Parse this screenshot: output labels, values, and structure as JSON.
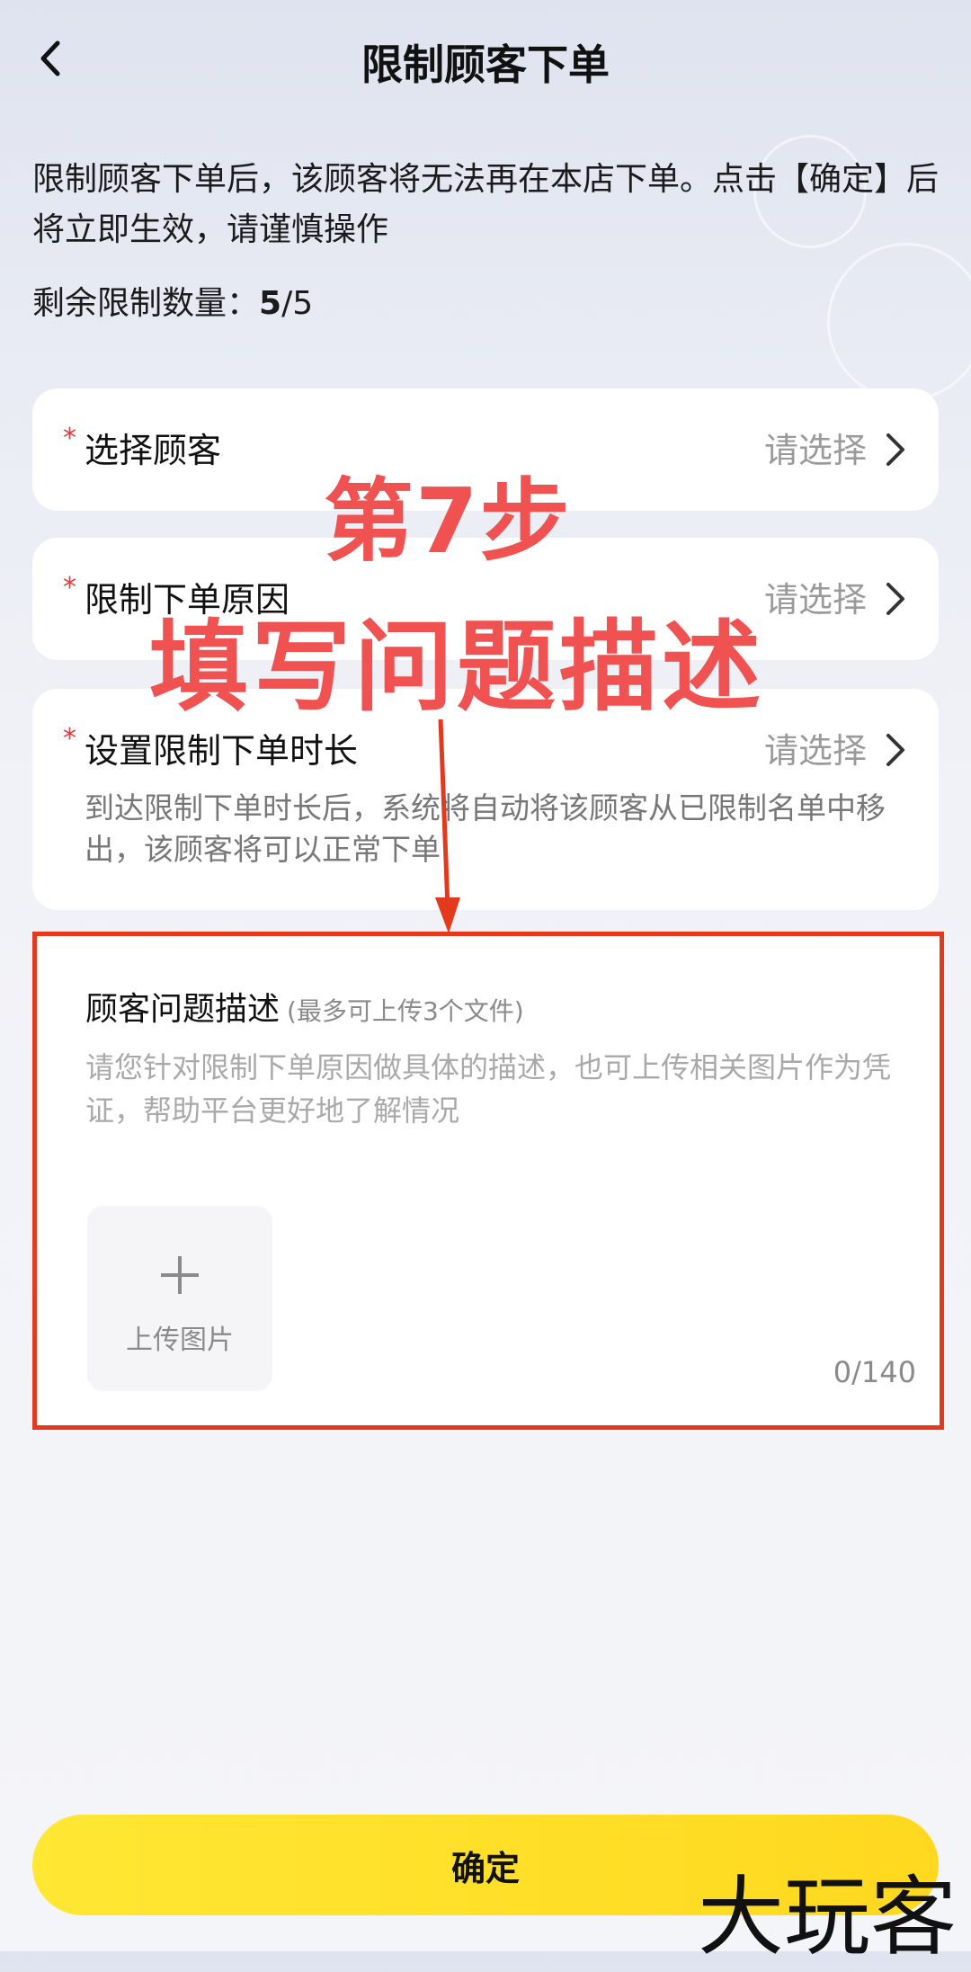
{
  "header": {
    "title": "限制顾客下单"
  },
  "notice": {
    "text": "限制顾客下单后，该顾客将无法再在本店下单。点击【确定】后将立即生效，请谨慎操作"
  },
  "remaining": {
    "label": "剩余限制数量：",
    "used": "5",
    "slash_total": "/5"
  },
  "fields": [
    {
      "required": "*",
      "label": "选择顾客",
      "value": "请选择"
    },
    {
      "required": "*",
      "label": "限制下单原因",
      "value": "请选择"
    },
    {
      "required": "*",
      "label": "设置限制下单时长",
      "value": "请选择",
      "hint": "到达限制下单时长后，系统将自动将该顾客从已限制名单中移出，该顾客将可以正常下单"
    }
  ],
  "description": {
    "title": "顾客问题描述",
    "subtitle": "(最多可上传3个文件)",
    "placeholder": "请您针对限制下单原因做具体的描述，也可上传相关图片作为凭证，帮助平台更好地了解情况",
    "upload_label": "上传图片",
    "counter": "0/140"
  },
  "overlay": {
    "step": "第7步",
    "instruction": "填写问题描述"
  },
  "confirm_label": "确定",
  "watermark": "大玩客",
  "colors": {
    "accent_yellow": "#ffe733",
    "required_red": "#e53935",
    "annotation_red": "#f05252",
    "highlight_border": "#e5391e"
  },
  "icons": {
    "back": "chevron-left-icon",
    "row": "chevron-right-icon",
    "upload": "plus-icon"
  }
}
